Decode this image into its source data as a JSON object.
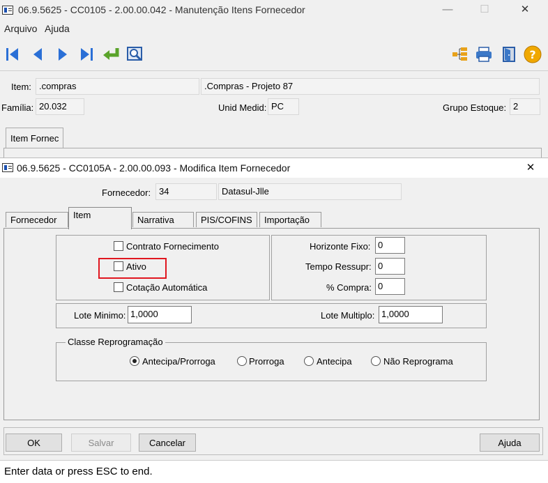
{
  "main_window": {
    "title": "06.9.5625 - CC0105 - 2.00.00.042 - Manutenção Itens Fornecedor",
    "menu": [
      "Arquivo",
      "Ajuda"
    ],
    "controls": {
      "minimize": "—",
      "maximize": "☐",
      "close": "✕"
    },
    "toolbar_left_icons": [
      "first-record-icon",
      "previous-record-icon",
      "next-record-icon",
      "last-record-icon",
      "goto-return-icon",
      "search-zoom-icon"
    ],
    "toolbar_right_icons": [
      "tree-icon",
      "print-icon",
      "exit-door-icon",
      "help-question-icon"
    ],
    "item_label": "Item:",
    "item_code": ".compras",
    "item_description": ".Compras - Projeto 87",
    "familia_label": "Família:",
    "familia_value": "20.032",
    "unid_label": "Unid Medid:",
    "unid_value": "PC",
    "grupo_label": "Grupo Estoque:",
    "grupo_value": "2",
    "tab": "Item Fornec"
  },
  "dialog": {
    "title": "06.9.5625 - CC0105A - 2.00.00.093 - Modifica Item Fornecedor",
    "close": "✕",
    "fornecedor_label": "Fornecedor:",
    "fornecedor_code": "34",
    "fornecedor_name": "Datasul-Jlle",
    "tabs": [
      "Fornecedor",
      "Item",
      "Narrativa",
      "PIS/COFINS",
      "Importação"
    ],
    "active_tab": "Item",
    "checkboxes": {
      "contrato": "Contrato Fornecimento",
      "ativo": "Ativo",
      "cotacao": "Cotação Automática"
    },
    "horizonte_label": "Horizonte Fixo:",
    "horizonte_value": "0",
    "tempo_label": "Tempo Ressupr:",
    "tempo_value": "0",
    "compra_label": "% Compra:",
    "compra_value": "0",
    "lote_min_label": "Lote Minimo:",
    "lote_min_value": "1,0000",
    "lote_mult_label": "Lote Multiplo:",
    "lote_mult_value": "1,0000",
    "classe_label": "Classe Reprogramação",
    "radios": [
      "Antecipa/Prorroga",
      "Prorroga",
      "Antecipa",
      "Não Reprograma"
    ],
    "radio_selected": "Antecipa/Prorroga",
    "highlight_color": "#e0161f",
    "buttons": {
      "ok": "OK",
      "salvar": "Salvar",
      "cancelar": "Cancelar",
      "ajuda": "Ajuda"
    }
  },
  "status_bar": "Enter data or press ESC to end."
}
